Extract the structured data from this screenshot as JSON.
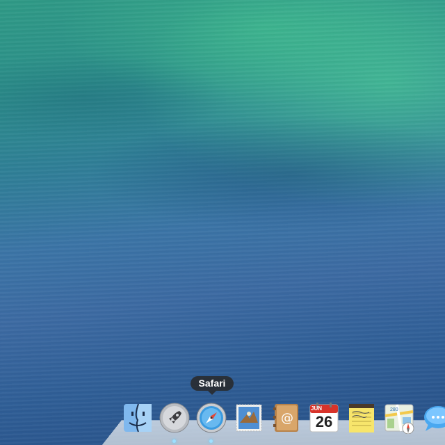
{
  "desktop": {
    "wallpaper": "wave-wallpaper"
  },
  "dock": {
    "tooltip": "Safari",
    "items": [
      {
        "name": "Finder",
        "icon": "finder-icon"
      },
      {
        "name": "Launchpad",
        "icon": "rocket-icon"
      },
      {
        "name": "Safari",
        "icon": "compass-icon"
      },
      {
        "name": "Mail",
        "icon": "stamp-icon"
      },
      {
        "name": "Contacts",
        "icon": "address-book-icon"
      },
      {
        "name": "Calendar",
        "icon": "calendar-icon",
        "month": "JUN",
        "day": "26"
      },
      {
        "name": "Notes",
        "icon": "notepad-icon"
      },
      {
        "name": "Maps",
        "icon": "map-icon",
        "badge": "280"
      },
      {
        "name": "Messages",
        "icon": "speech-bubble-icon"
      }
    ]
  },
  "colors": {
    "tooltip_bg": "#282828",
    "wallpaper_top": "#2f9a86",
    "wallpaper_bottom": "#274f86"
  }
}
